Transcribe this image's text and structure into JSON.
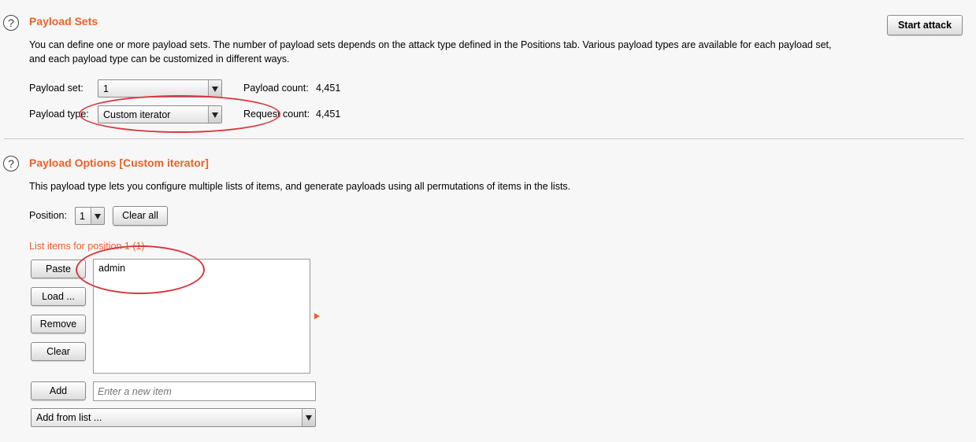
{
  "payload_sets": {
    "title": "Payload Sets",
    "description_line1": "You can define one or more payload sets. The number of payload sets depends on the attack type defined in the Positions tab. Various payload types are available for each payload set,",
    "description_line2": "and each payload type can be customized in different ways.",
    "start_attack_label": "Start attack",
    "payload_set_label": "Payload set:",
    "payload_set_value": "1",
    "payload_count_label": "Payload count:",
    "payload_count_value": "4,451",
    "payload_type_label": "Payload type:",
    "payload_type_value": "Custom iterator",
    "request_count_label": "Request count:",
    "request_count_value": "4,451"
  },
  "payload_options": {
    "title": "Payload Options [Custom iterator]",
    "description": "This payload type lets you configure multiple lists of items, and generate payloads using all permutations of items in the lists.",
    "position_label": "Position:",
    "position_value": "1",
    "clear_all_label": "Clear all",
    "list_items_label": "List items for position 1 (1)",
    "buttons": {
      "paste": "Paste",
      "load": "Load ...",
      "remove": "Remove",
      "clear": "Clear",
      "add": "Add"
    },
    "list_items": [
      "admin"
    ],
    "new_item_placeholder": "Enter a new item",
    "add_from_list_value": "Add from list ..."
  },
  "icons": {
    "help": "help-icon",
    "dropdown": "chevron-down-icon",
    "expand": "triangle-right-icon"
  },
  "colors": {
    "accent": "#e8622a",
    "annotation": "#d9363e"
  }
}
